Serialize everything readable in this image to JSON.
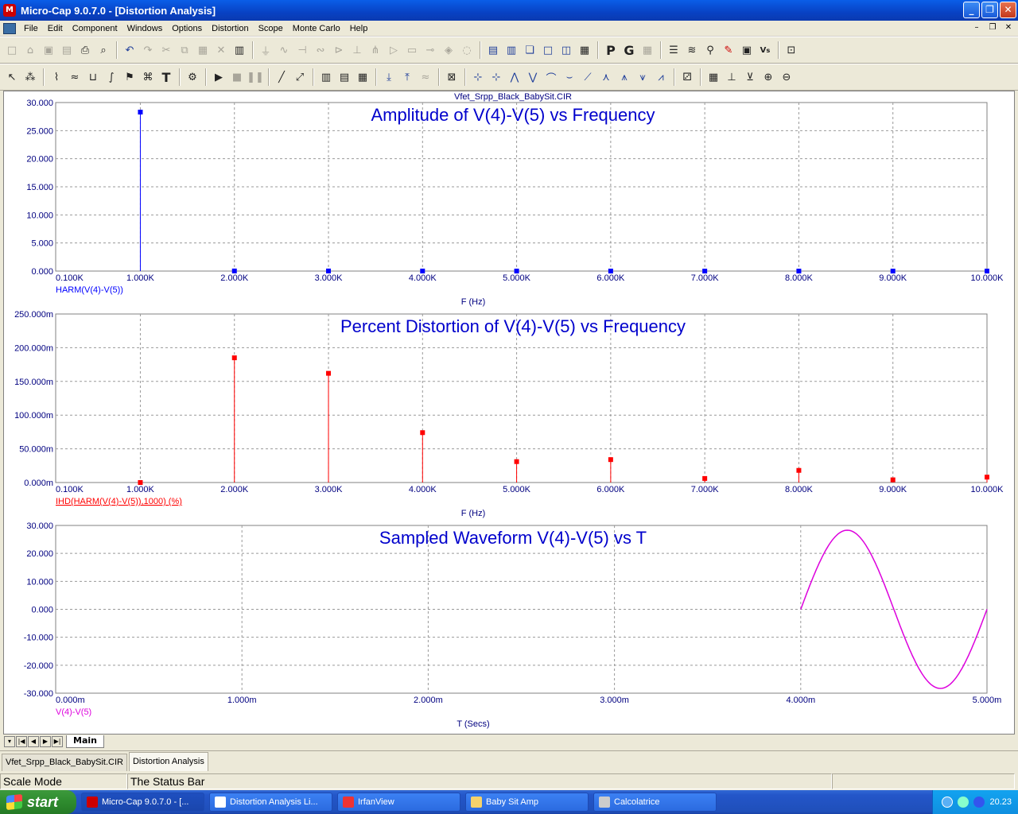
{
  "window": {
    "title": "Micro-Cap 9.0.7.0 - [Distortion Analysis]",
    "app_icon": "micro-cap-icon",
    "controls": [
      "minimize-icon",
      "restore-icon",
      "close-icon"
    ]
  },
  "menu": {
    "items": [
      "File",
      "Edit",
      "Component",
      "Windows",
      "Options",
      "Distortion",
      "Scope",
      "Monte Carlo",
      "Help"
    ]
  },
  "toolbar1": {
    "icons": [
      "new-icon",
      "open-icon",
      "save-icon",
      "save-all-icon",
      "print-icon",
      "print-preview-icon",
      "undo-icon",
      "redo-icon",
      "cut-icon",
      "copy-icon",
      "paste-icon",
      "delete-icon",
      "select-all-icon",
      "ground-icon",
      "resistor-icon",
      "capacitor-icon",
      "inductor-icon",
      "diode-icon",
      "battery-icon",
      "npn-icon",
      "opamp-icon",
      "wire-icon",
      "source-icon",
      "junction-icon",
      "tile-horizontal-icon",
      "tile-vertical-icon",
      "cascade-icon",
      "window-icon",
      "split-icon",
      "calculator-icon",
      "p-icon",
      "g-icon",
      "layout-icon",
      "list-icon",
      "waveform-icon",
      "probe-icon",
      "pen-icon",
      "stepping-icon",
      "vs-icon",
      "zoom-extent-icon"
    ]
  },
  "toolbar2": {
    "icons": [
      "pointer-icon",
      "component-icon",
      "graph-icon",
      "wave-icon",
      "bus-icon",
      "flag-icon",
      "text-icon",
      "properties-icon",
      "run-icon",
      "stop-icon",
      "pause-icon",
      "line-icon",
      "diagonal-icon",
      "grid-icon",
      "minor-grid-icon",
      "grid-box-icon",
      "cursor-left-icon",
      "cursor-right-icon",
      "marker-icon",
      "peak-icon",
      "valley-icon",
      "high-icon",
      "low-icon",
      "slope-icon",
      "inflection-icon",
      "global-high-icon",
      "global-low-icon",
      "stack-icon",
      "data-icon",
      "scale-icon",
      "fixed-scale-icon",
      "zoom-in-icon",
      "zoom-out-icon"
    ]
  },
  "plot": {
    "file_title": "Vfet_Srpp_Black_BabySit.CIR",
    "panels": [
      {
        "title": "Amplitude of V(4)-V(5) vs Frequency",
        "y_ticks": [
          "30.000",
          "25.000",
          "20.000",
          "15.000",
          "10.000",
          "5.000",
          "0.000"
        ],
        "x_ticks": [
          "0.100K",
          "1.000K",
          "2.000K",
          "3.000K",
          "4.000K",
          "5.000K",
          "6.000K",
          "7.000K",
          "8.000K",
          "9.000K",
          "10.000K"
        ],
        "x_label": "F (Hz)",
        "trace_label": "HARM(V(4)-V(5))"
      },
      {
        "title": "Percent Distortion of V(4)-V(5) vs Frequency",
        "y_ticks": [
          "250.000m",
          "200.000m",
          "150.000m",
          "100.000m",
          "50.000m",
          "0.000m"
        ],
        "x_ticks": [
          "0.100K",
          "1.000K",
          "2.000K",
          "3.000K",
          "4.000K",
          "5.000K",
          "6.000K",
          "7.000K",
          "8.000K",
          "9.000K",
          "10.000K"
        ],
        "x_label": "F (Hz)",
        "trace_label": "IHD(HARM(V(4)-V(5)),1000) (%)"
      },
      {
        "title": "Sampled Waveform  V(4)-V(5) vs T",
        "y_ticks": [
          "30.000",
          "20.000",
          "10.000",
          "0.000",
          "-10.000",
          "-20.000",
          "-30.000"
        ],
        "x_ticks": [
          "0.000m",
          "1.000m",
          "2.000m",
          "3.000m",
          "4.000m",
          "5.000m"
        ],
        "x_label": "T (Secs)",
        "trace_label": "V(4)-V(5)"
      }
    ]
  },
  "chart_data": [
    {
      "type": "bar",
      "title": "Amplitude of V(4)-V(5) vs Frequency",
      "xlabel": "F (Hz)",
      "ylabel": "",
      "xlim": [
        100,
        10000
      ],
      "ylim": [
        0,
        30
      ],
      "grid": true,
      "series": [
        {
          "name": "HARM(V(4)-V(5))",
          "color": "#0000ff",
          "x": [
            1000,
            2000,
            3000,
            4000,
            5000,
            6000,
            7000,
            8000,
            9000,
            10000
          ],
          "y": [
            28.3,
            0.02,
            0.02,
            0.01,
            0.005,
            0.005,
            0.002,
            0.003,
            0.001,
            0.001
          ]
        }
      ]
    },
    {
      "type": "bar",
      "title": "Percent Distortion of V(4)-V(5) vs Frequency",
      "xlabel": "F (Hz)",
      "ylabel": "",
      "xlim": [
        100,
        10000
      ],
      "ylim": [
        0,
        0.25
      ],
      "grid": true,
      "series": [
        {
          "name": "IHD(HARM(V(4)-V(5)),1000) (%)",
          "color": "#ff0000",
          "x": [
            1000,
            2000,
            3000,
            4000,
            5000,
            6000,
            7000,
            8000,
            9000,
            10000
          ],
          "y": [
            0.0,
            0.185,
            0.162,
            0.074,
            0.031,
            0.034,
            0.006,
            0.018,
            0.004,
            0.008
          ]
        }
      ]
    },
    {
      "type": "line",
      "title": "Sampled Waveform  V(4)-V(5) vs T",
      "xlabel": "T (Secs)",
      "ylabel": "",
      "xlim": [
        0,
        0.005
      ],
      "ylim": [
        -30,
        30
      ],
      "grid": true,
      "series": [
        {
          "name": "V(4)-V(5)",
          "color": "#dd00dd",
          "x": [
            0.004,
            0.004125,
            0.00425,
            0.004375,
            0.0045,
            0.004625,
            0.00475,
            0.004875,
            0.005
          ],
          "y": [
            0,
            20,
            28.3,
            20,
            0,
            -20,
            -28.3,
            -20,
            0
          ]
        }
      ]
    }
  ],
  "sheet": {
    "tab": "Main",
    "nav": [
      "first-icon",
      "prev-icon",
      "next-icon",
      "last-icon"
    ]
  },
  "doc_tabs": [
    "Vfet_Srpp_Black_BabySit.CIR",
    "Distortion Analysis"
  ],
  "status": {
    "mode": "Scale Mode",
    "message": "The Status Bar"
  },
  "taskbar": {
    "start": "start",
    "tasks": [
      "Micro-Cap 9.0.7.0 - [...",
      "Distortion Analysis Li...",
      "IrfanView",
      "Baby Sit Amp",
      "Calcolatrice"
    ],
    "clock": "20.23"
  },
  "colors": {
    "trace1": "#0000ff",
    "trace2": "#ff0000",
    "trace3": "#dd00dd",
    "title_text": "#0000cc",
    "axis_label": "#000080"
  }
}
